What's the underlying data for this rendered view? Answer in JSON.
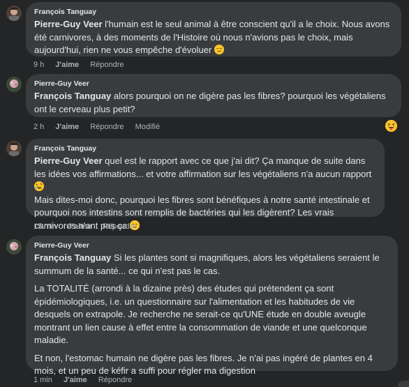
{
  "comments": [
    {
      "author": "François Tanguay",
      "mention": "Pierre-Guy Veer",
      "paragraphs": [
        " l'humain est le seul animal à être conscient qu'il a le choix. Nous avons été carnivores, à des moments de l'Histoire où nous n'avions pas le choix, mais aujourd'hui, rien ne vous empêche d'évoluer"
      ],
      "time": "9 h",
      "like": "J'aime",
      "reply": "Répondre"
    },
    {
      "author": "Pierre-Guy Veer",
      "mention": "François Tanguay",
      "paragraphs": [
        " alors pourquoi on ne digère pas les fibres? pourquoi les végétaliens ont le cerveau plus petit?"
      ],
      "time": "2 h",
      "like": "J'aime",
      "reply": "Répondre",
      "edited": "Modifié"
    },
    {
      "author": "François Tanguay",
      "mention": "Pierre-Guy Veer",
      "paragraphs": [
        " quel est le rapport avec ce que j'ai dit? Ça manque de suite dans les idées vos affirmations... et votre affirmation sur les végétaliens n'a aucun rapport",
        "Mais dites-moi donc, pourquoi les fibres sont bénéfiques à notre santé intestinale et pourquoi nos intestins sont remplis de bactéries qui les digèrent? Les vrais carnivores n'ont pas ça"
      ],
      "time": "15 min",
      "like": "J'aime",
      "reply": "Répondre"
    },
    {
      "author": "Pierre-Guy Veer",
      "mention": "François Tanguay",
      "paragraphs": [
        " Si les plantes sont si magnifiques, alors les végétaliens seraient le summum de la santé... ce qui n'est pas le cas.",
        "La TOTALITÉ (arrondi à la dizaine près) des études qui prétendent ça sont épidémiologiques, i.e. un questionnaire sur l'alimentation et les habitudes de vie desquels on extrapole. Je recherche ne serait-ce qu'UNE étude en double aveugle montrant un lien cause à effet entre la consommation de viande et une quelconque maladie.",
        "Et non, l'estomac humain ne digère pas les fibres. Je n'ai pas ingéré de plantes en 4 mois, et un peu de kéfir a suffi pour régler ma digestion"
      ],
      "time": "1 min",
      "like": "J'aime",
      "reply": "Répondre"
    }
  ],
  "icons": {
    "smirk": "smirking-face-emoji",
    "laugh": "rolling-laughing-emoji",
    "tongue": "squinting-tongue-emoji"
  }
}
